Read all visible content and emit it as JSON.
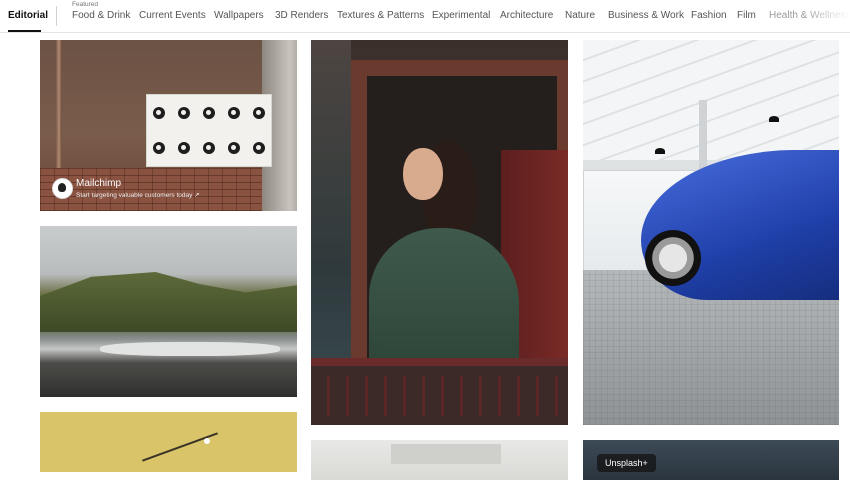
{
  "nav": {
    "tabs": [
      {
        "label": "Editorial",
        "active": true
      },
      {
        "label": "Food & Drink",
        "eyebrow": "Featured"
      },
      {
        "label": "Current Events"
      },
      {
        "label": "Wallpapers"
      },
      {
        "label": "3D Renders"
      },
      {
        "label": "Textures & Patterns"
      },
      {
        "label": "Experimental"
      },
      {
        "label": "Architecture"
      },
      {
        "label": "Nature"
      },
      {
        "label": "Business & Work"
      },
      {
        "label": "Fashion"
      },
      {
        "label": "Film"
      },
      {
        "label": "Health & Wellness"
      }
    ]
  },
  "grid": {
    "sponsor": {
      "name": "Mailchimp",
      "tagline": "Start targeting valuable customers today ↗",
      "logo_icon": "mailchimp-logo-icon"
    },
    "badge": {
      "label": "Unsplash+"
    }
  }
}
